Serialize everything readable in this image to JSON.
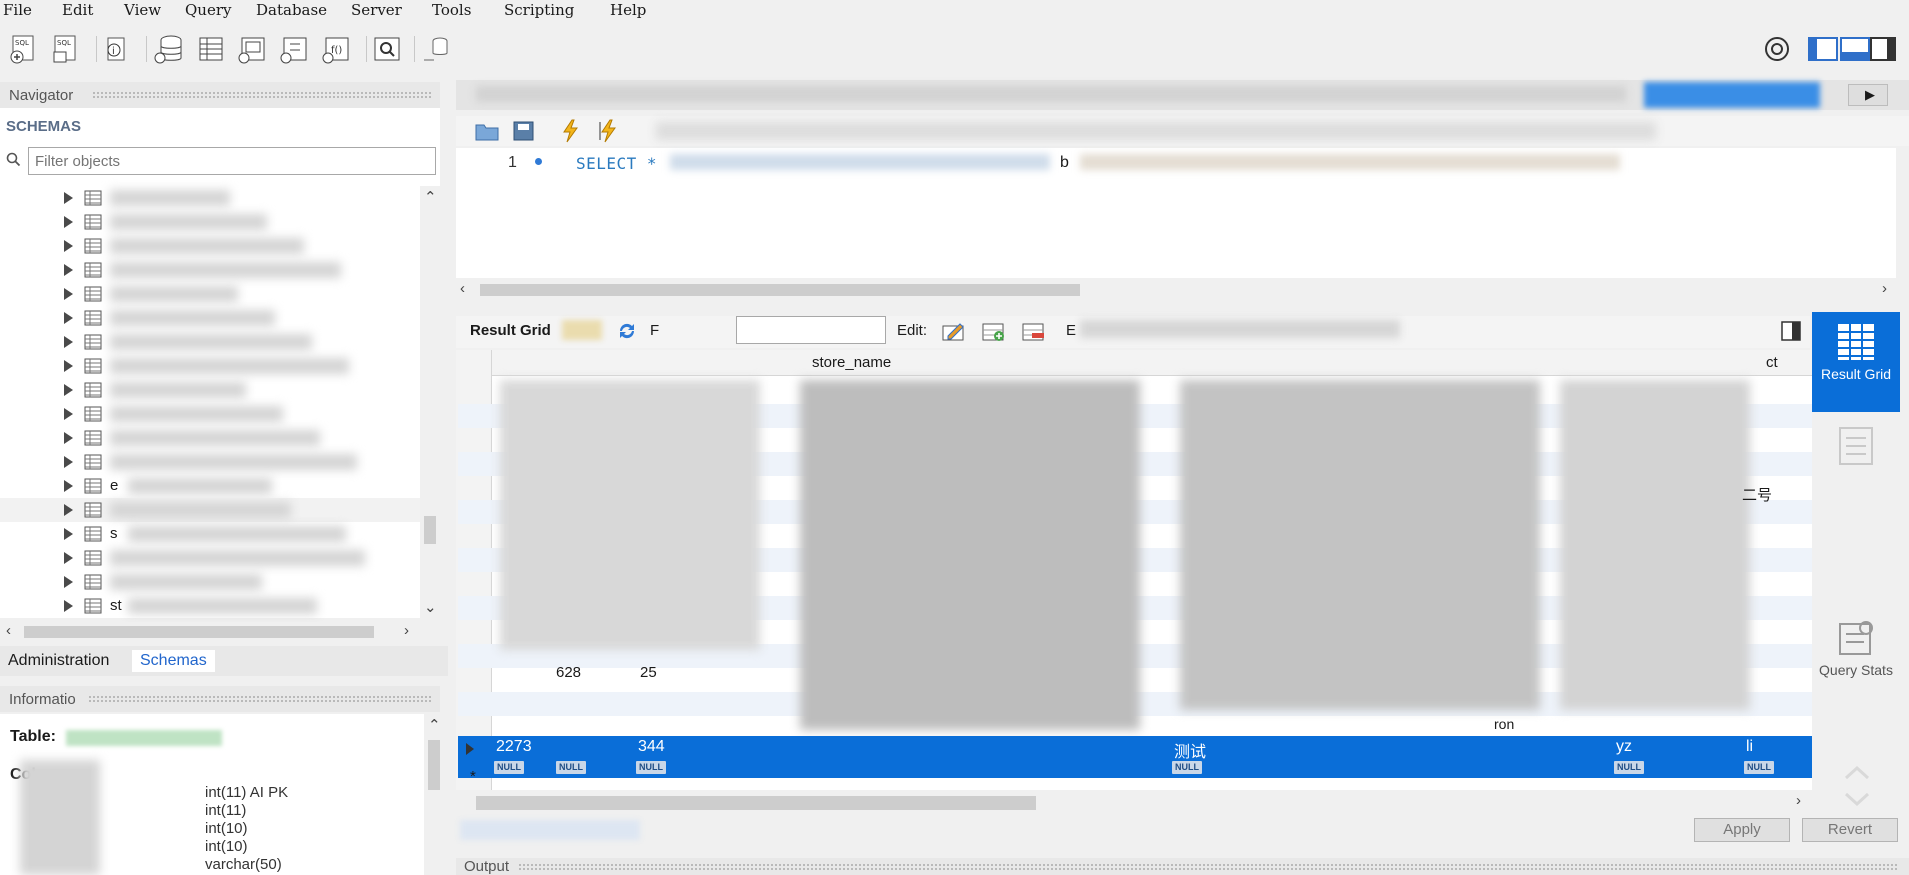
{
  "menu": [
    "File",
    "Edit",
    "View",
    "Query",
    "Database",
    "Server",
    "Tools",
    "Scripting",
    "Help"
  ],
  "toolbar": {
    "icons": [
      "new-sql-tab-icon",
      "open-sql-script-icon",
      "inspector-icon",
      "create-schema-icon",
      "create-table-icon",
      "create-view-icon",
      "create-procedure-icon",
      "create-function-icon",
      "search-table-data-icon",
      "reconnect-icon"
    ],
    "right_icons": [
      "settings-icon",
      "toggle-sidebar-icon",
      "toggle-output-icon",
      "toggle-secondary-sidebar-icon"
    ]
  },
  "navigator": {
    "title": "Navigator",
    "schemas_label": "SCHEMAS",
    "filter_placeholder": "Filter objects",
    "visible_tree_text": {
      "row13": "e",
      "row15": "s",
      "row18": "st"
    },
    "tabs": {
      "administration": "Administration",
      "schemas": "Schemas"
    },
    "info_title": "Informatio",
    "table_label": "Table:",
    "columns_label": "Col",
    "column_types": [
      "int(11) AI PK",
      "int(11)",
      "int(10)",
      "int(10)",
      "varchar(50)"
    ]
  },
  "editor": {
    "line_number": "1",
    "sql": "SELECT *",
    "sql_tail": "b"
  },
  "result": {
    "grid_label": "Result Grid",
    "filter_label": "F",
    "edit_label": "Edit:",
    "export_label": "E",
    "columns": {
      "store_name": "store_name",
      "last": "ct"
    },
    "visible_rows": [
      {
        "a": "628",
        "b": "25"
      }
    ],
    "selected_row": {
      "c1": "2273",
      "c2": "344",
      "c3": "测试",
      "c4": "yz",
      "c5": "li",
      "null_text": "NULL"
    },
    "fragments": [
      "二号",
      "ron"
    ],
    "new_row_marker": "*"
  },
  "side_panel": {
    "result_grid": "Result Grid",
    "query_stats": "Query Stats"
  },
  "actions": {
    "apply": "Apply",
    "revert": "Revert"
  },
  "output": {
    "title": "Output"
  },
  "colors": {
    "accent": "#0a6ed8",
    "sql_keyword": "#2a7abf"
  }
}
